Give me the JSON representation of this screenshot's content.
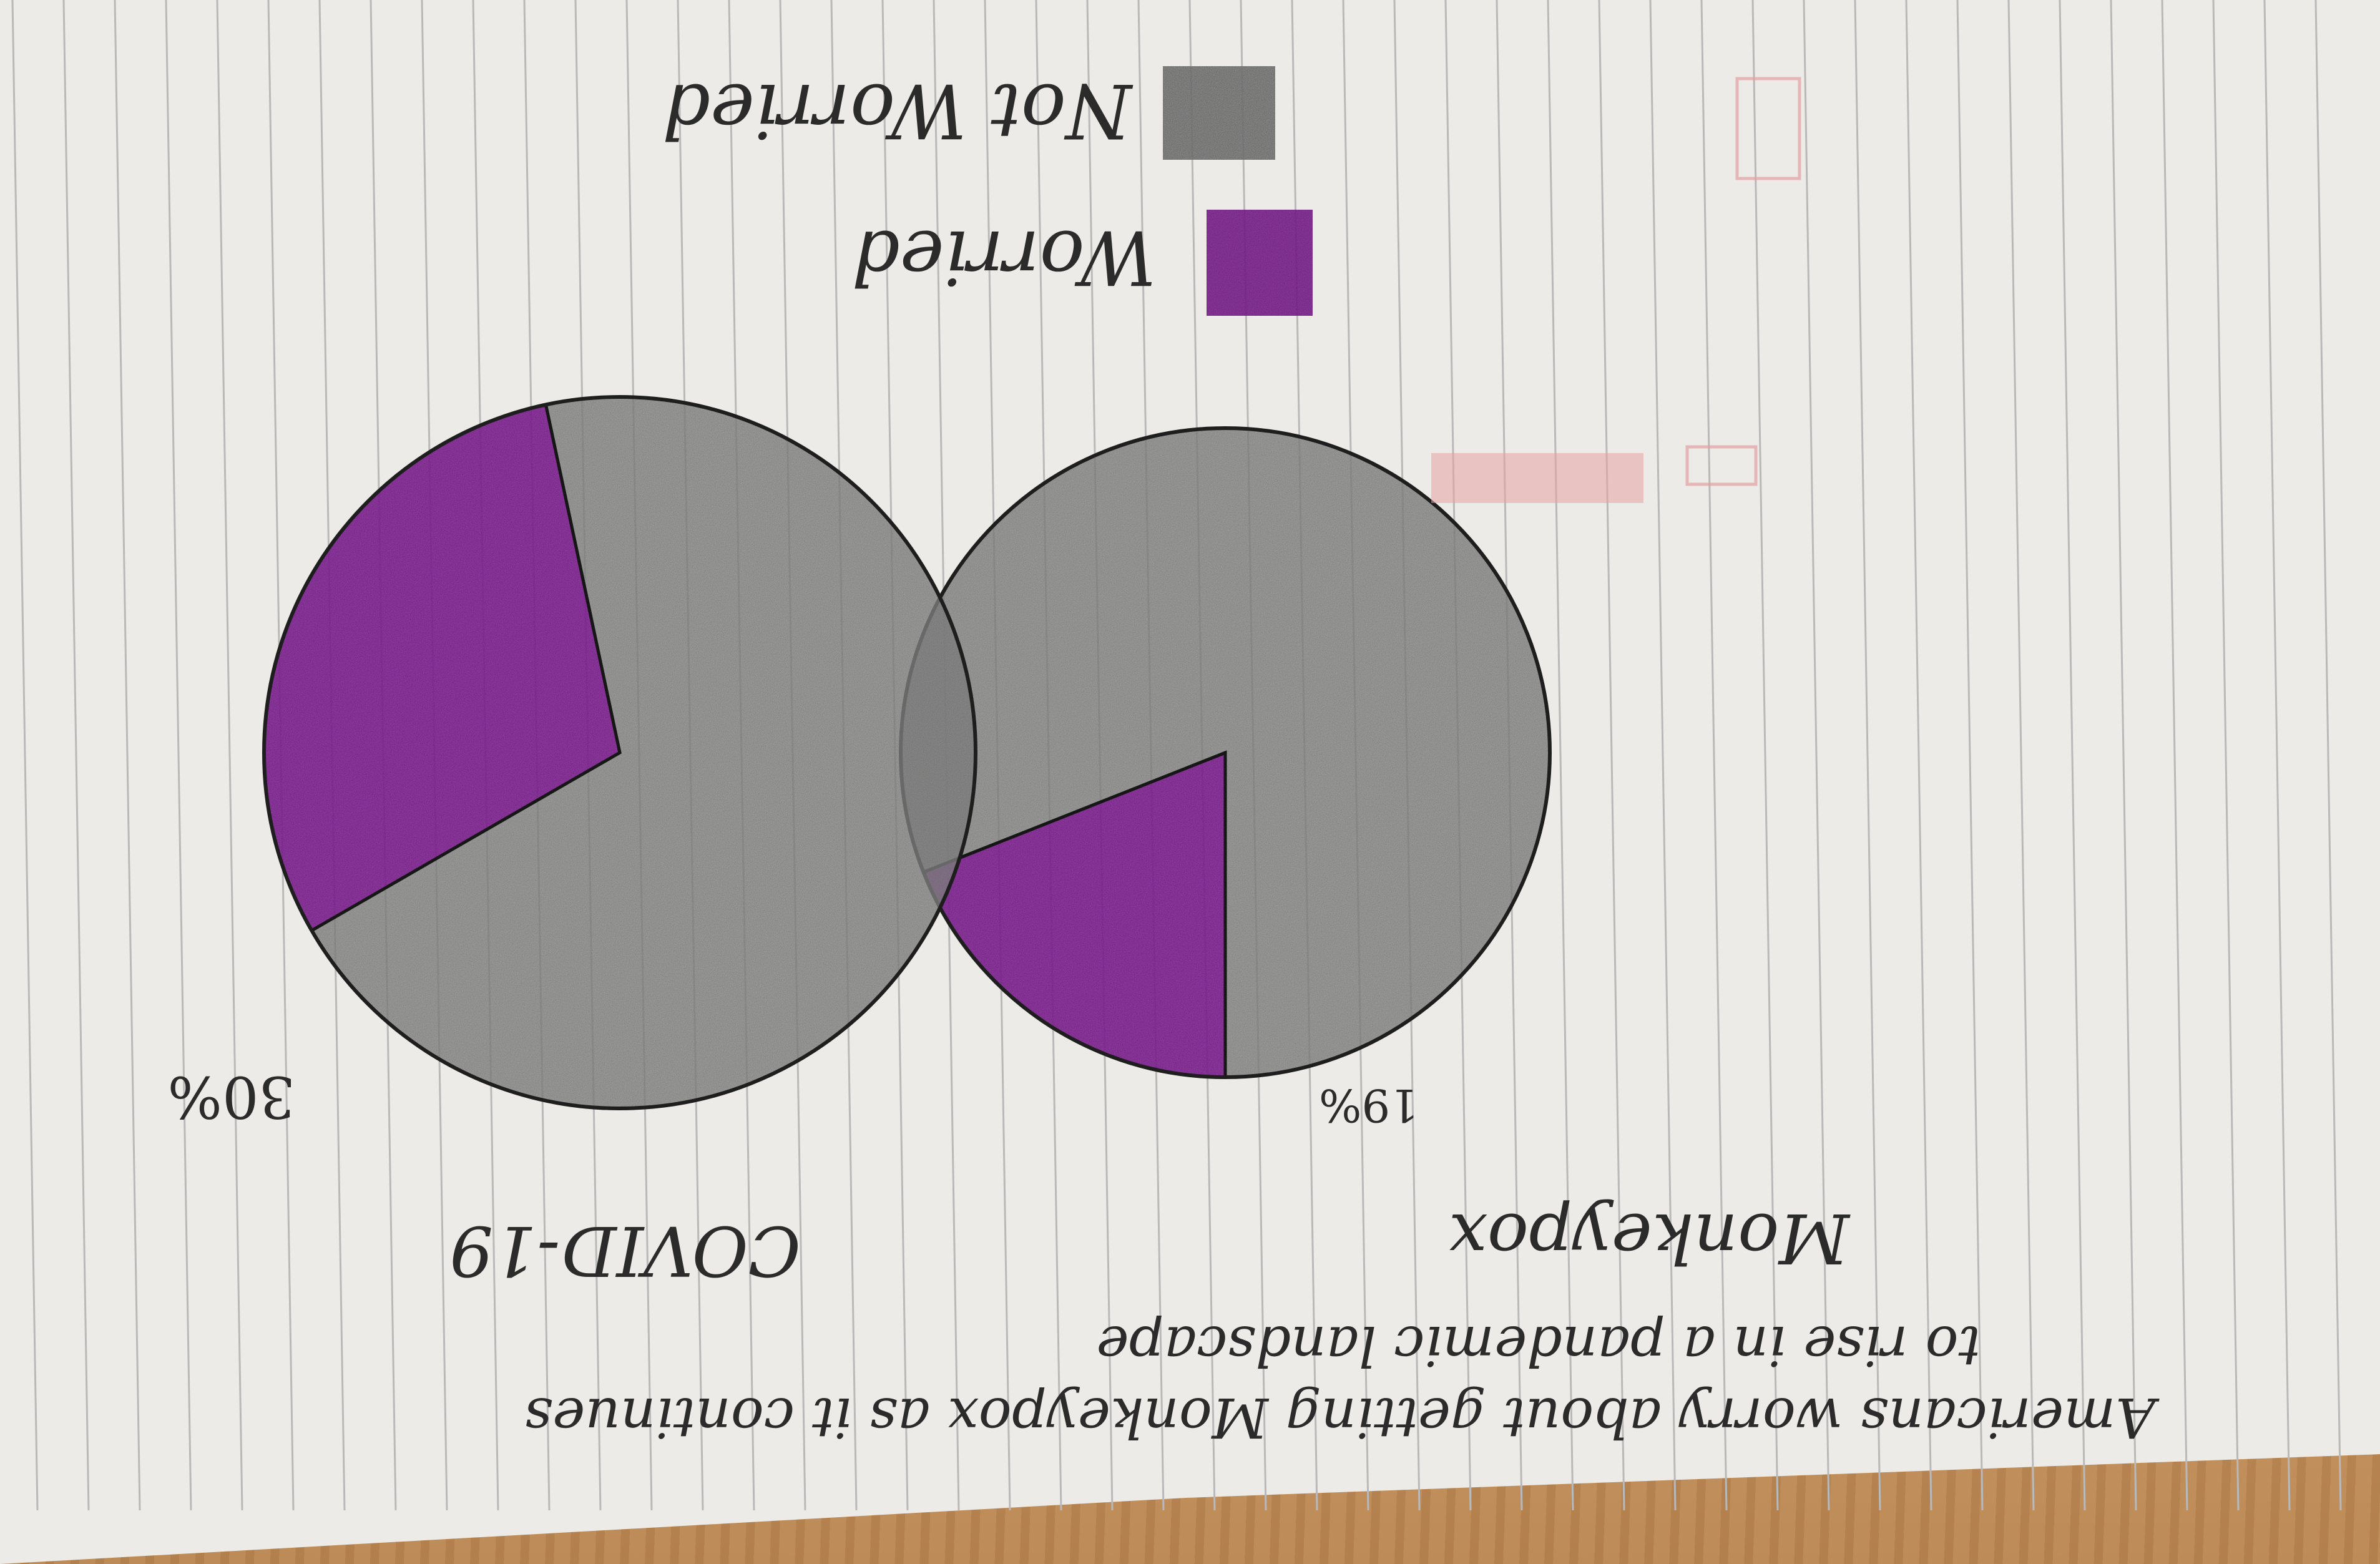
{
  "chart_data": {
    "type": "pie",
    "title": "Americans worry about getting Monkeypox as it continues to rise in a pandemic landscape",
    "legend": {
      "placement": "top",
      "entries": [
        {
          "label": "Worried",
          "color": "#8e2aa0"
        },
        {
          "label": "Not Worried",
          "color": "#8a8a8a"
        }
      ]
    },
    "pies": [
      {
        "name": "Monkeypox",
        "slices": [
          {
            "label": "Worried",
            "value": 19
          },
          {
            "label": "Not Worried",
            "value": 81
          }
        ],
        "value_label": "19%"
      },
      {
        "name": "COVID-19",
        "slices": [
          {
            "label": "Worried",
            "value": 30
          },
          {
            "label": "Not Worried",
            "value": 70
          }
        ],
        "value_label": "30%"
      }
    ]
  }
}
